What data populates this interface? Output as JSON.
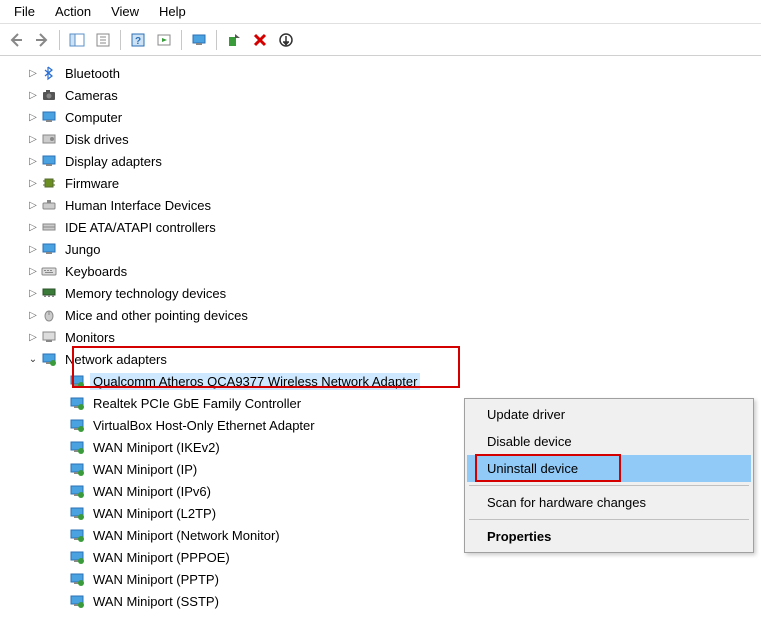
{
  "menubar": {
    "file": "File",
    "action": "Action",
    "view": "View",
    "help": "Help"
  },
  "tree": {
    "bluetooth": "Bluetooth",
    "cameras": "Cameras",
    "computer": "Computer",
    "disk_drives": "Disk drives",
    "display_adapters": "Display adapters",
    "firmware": "Firmware",
    "hid": "Human Interface Devices",
    "ide": "IDE ATA/ATAPI controllers",
    "jungo": "Jungo",
    "keyboards": "Keyboards",
    "memory_tech": "Memory technology devices",
    "mice": "Mice and other pointing devices",
    "monitors": "Monitors",
    "network_adapters": "Network adapters",
    "net_children": {
      "qca": "Qualcomm Atheros QCA9377 Wireless Network Adapter",
      "realtek": "Realtek PCIe GbE Family Controller",
      "vbox": "VirtualBox Host-Only Ethernet Adapter",
      "ikev2": "WAN Miniport (IKEv2)",
      "ip": "WAN Miniport (IP)",
      "ipv6": "WAN Miniport (IPv6)",
      "l2tp": "WAN Miniport (L2TP)",
      "nm": "WAN Miniport (Network Monitor)",
      "pppoe": "WAN Miniport (PPPOE)",
      "pptp": "WAN Miniport (PPTP)",
      "sstp": "WAN Miniport (SSTP)"
    }
  },
  "context_menu": {
    "update": "Update driver",
    "disable": "Disable device",
    "uninstall": "Uninstall device",
    "scan": "Scan for hardware changes",
    "properties": "Properties"
  }
}
